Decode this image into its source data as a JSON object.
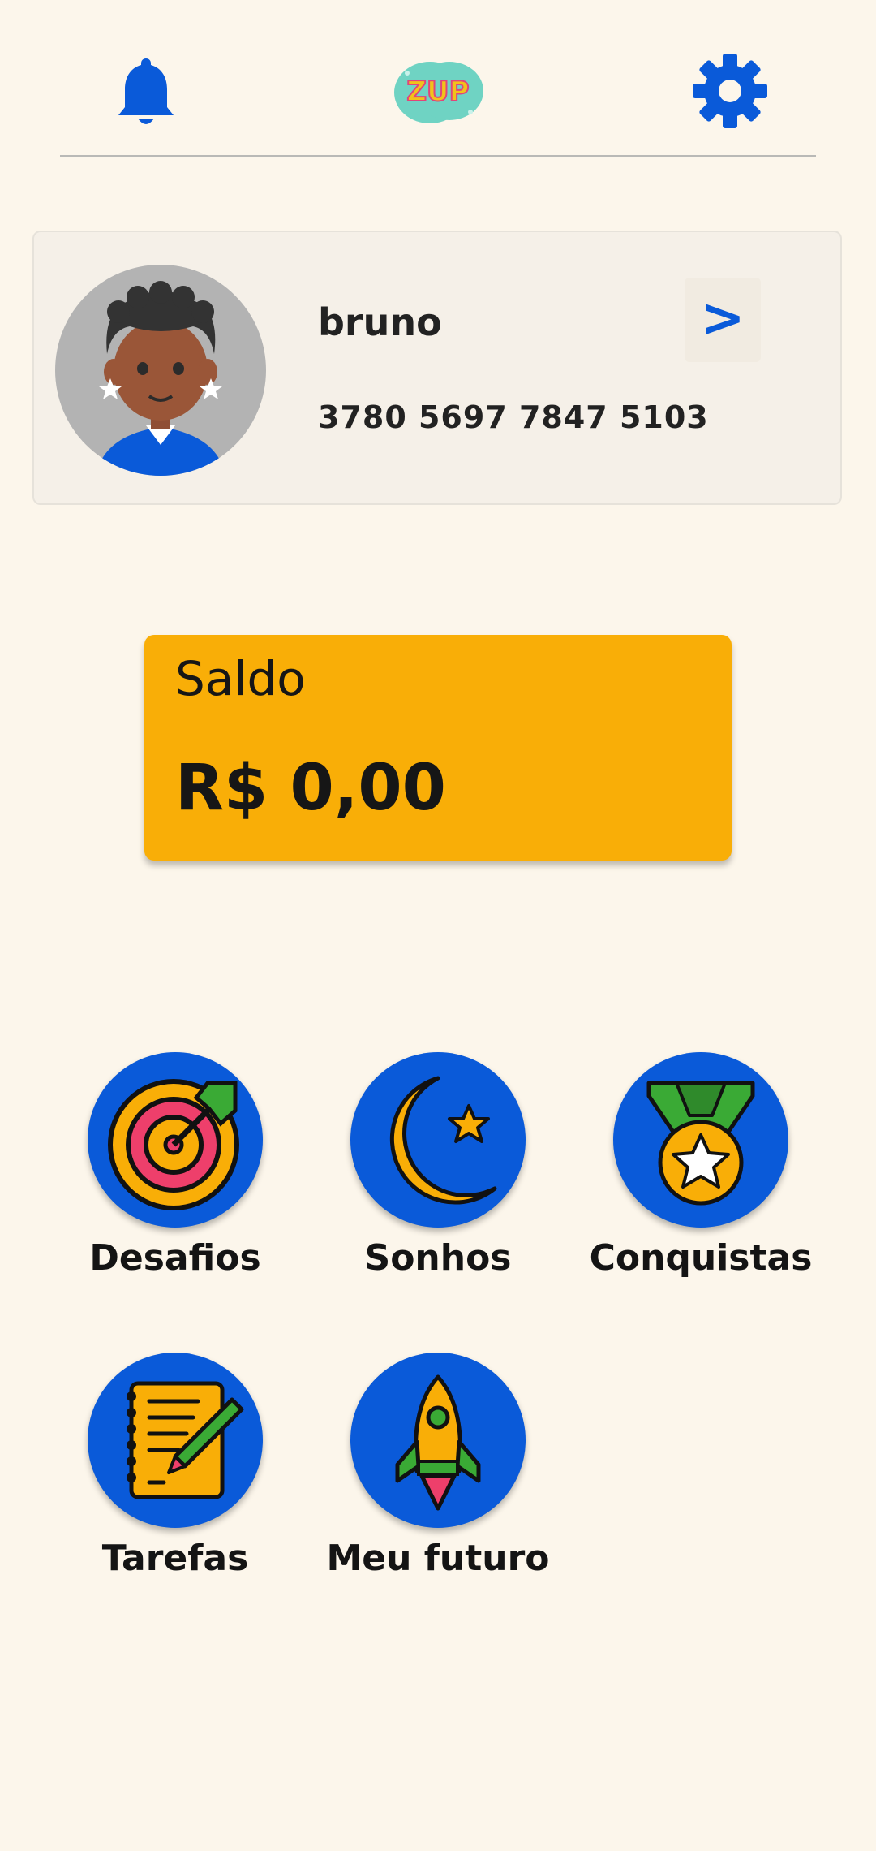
{
  "header": {
    "logo_text": "ZUP",
    "icons": [
      "bell-icon",
      "zup-logo",
      "gear-icon"
    ],
    "accent_color": "#0a5ad9"
  },
  "profile": {
    "name": "bruno",
    "account_number": "3780 5697 7847 5103",
    "arrow": ">"
  },
  "balance": {
    "label": "Saldo",
    "value": "R$ 0,00",
    "color": "#f9ae07"
  },
  "menu": {
    "items": [
      {
        "label": "Desafios",
        "icon": "target-icon"
      },
      {
        "label": "Sonhos",
        "icon": "moon-star-icon"
      },
      {
        "label": "Conquistas",
        "icon": "medal-icon"
      },
      {
        "label": "Tarefas",
        "icon": "notebook-icon"
      },
      {
        "label": "Meu futuro",
        "icon": "rocket-icon"
      }
    ]
  }
}
